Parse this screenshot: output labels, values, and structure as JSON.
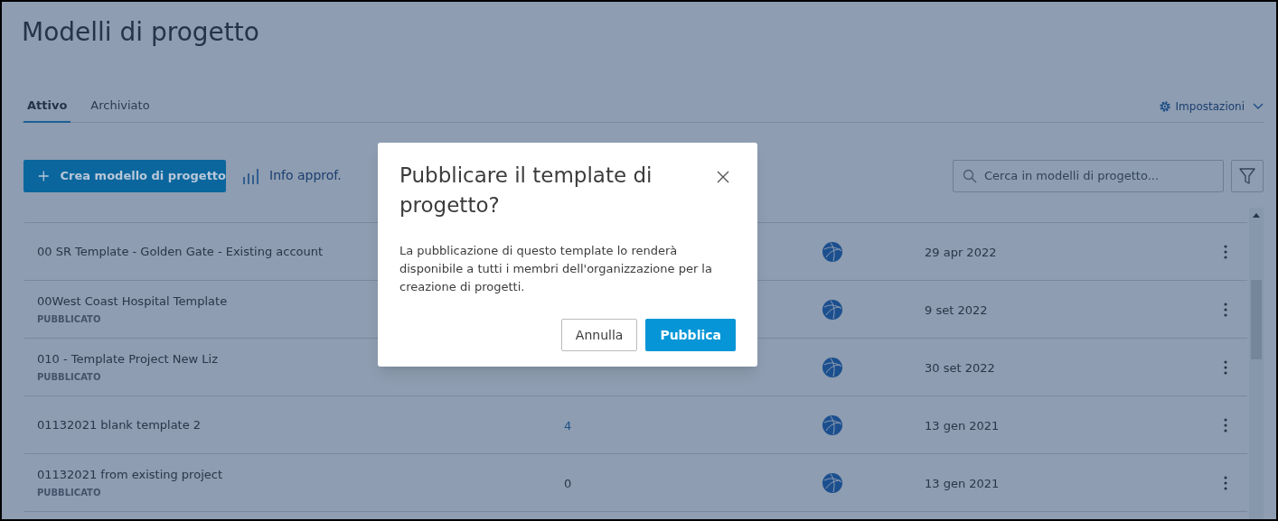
{
  "page": {
    "title": "Modelli di progetto"
  },
  "tabs": [
    {
      "label": "Attivo",
      "selected": true
    },
    {
      "label": "Archiviato",
      "selected": false
    }
  ],
  "settings": {
    "label": "Impostazioni"
  },
  "toolbar": {
    "create_button": "Crea modello di progetto",
    "insights_link": "Info approf.",
    "search": {
      "placeholder": "Cerca in modelli di progetto..."
    }
  },
  "rows": [
    {
      "name": "00 SR Template - Golden Gate - Existing account",
      "date": "29 apr 2022"
    },
    {
      "name": "00West Coast Hospital Template",
      "status": "PUBBLICATO",
      "date": "9 set 2022"
    },
    {
      "name": "010 - Template Project New Liz",
      "status": "PUBBLICATO",
      "date": "30 set 2022"
    },
    {
      "name": "01132021 blank template 2",
      "count": "4",
      "count_linked": true,
      "date": "13 gen 2021"
    },
    {
      "name": "01132021 from existing project",
      "status": "PUBBLICATO",
      "count": "0",
      "count_linked": false,
      "date": "13 gen 2021"
    }
  ],
  "dialog": {
    "title": "Pubblicare il template di progetto?",
    "message": "La pubblicazione di questo template lo renderà disponibile a tutti i membri dell'organizzazione per la creazione di progetti.",
    "buttons": [
      {
        "label": "Annulla",
        "kind": "secondary"
      },
      {
        "label": "Pubblica",
        "kind": "primary"
      }
    ]
  }
}
